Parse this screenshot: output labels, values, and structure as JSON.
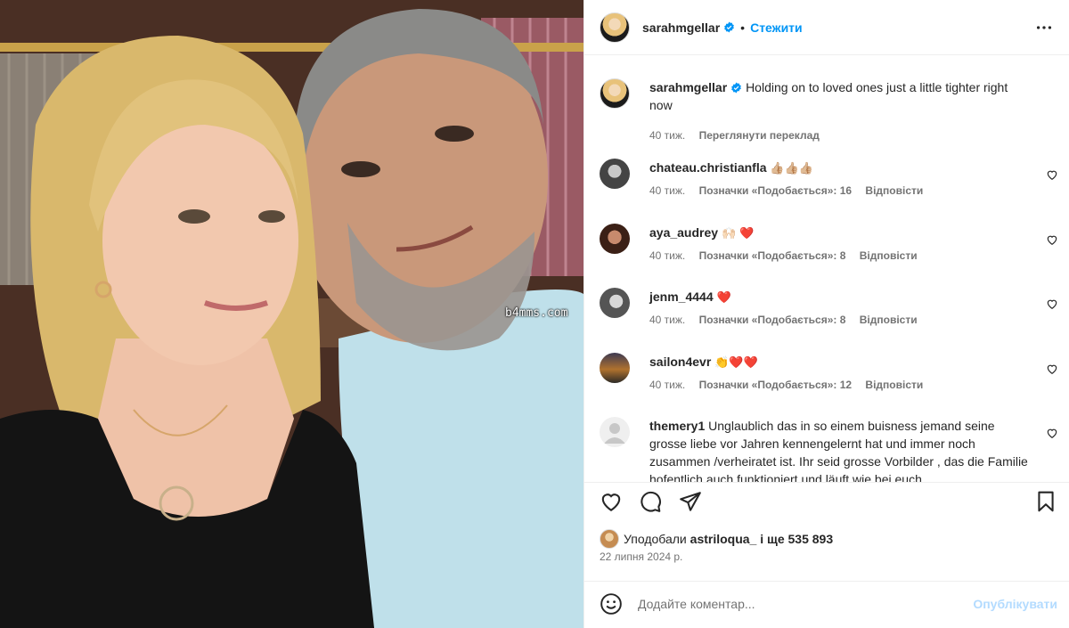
{
  "photo": {
    "watermark": "b4mms.com"
  },
  "header": {
    "username": "sarahmgellar",
    "dot": "•",
    "follow_label": "Стежити",
    "verified_icon": "verified-badge-icon",
    "more_icon": "more-options-icon"
  },
  "caption": {
    "username": "sarahmgellar",
    "text": "Holding on to loved ones just a little tighter right now",
    "time": "40 тиж.",
    "translate": "Переглянути переклад"
  },
  "comments": [
    {
      "username": "chateau.christianfla",
      "text": "👍🏼👍🏼👍🏼",
      "time": "40 тиж.",
      "likes": "Позначки «Подобається»: 16",
      "reply": "Відповісти"
    },
    {
      "username": "aya_audrey",
      "text": "🙌🏻 ❤️",
      "time": "40 тиж.",
      "likes": "Позначки «Подобається»: 8",
      "reply": "Відповісти"
    },
    {
      "username": "jenm_4444",
      "text": "❤️",
      "time": "40 тиж.",
      "likes": "Позначки «Подобається»: 8",
      "reply": "Відповісти"
    },
    {
      "username": "sailon4evr",
      "text": "👏❤️❤️",
      "time": "40 тиж.",
      "likes": "Позначки «Подобається»: 12",
      "reply": "Відповісти"
    },
    {
      "username": "themery1",
      "text": "Unglaublich das in so einem buisness jemand seine grosse liebe vor Jahren kennengelernt hat und immer noch zusammen /verheiratet ist. Ihr seid grosse Vorbilder , das die Familie hofentlich auch funktioniert und läuft wie bei euch."
    }
  ],
  "likes": {
    "prefix": "Уподобали",
    "user": "astriloqua_",
    "suffix": "і ще 535 893"
  },
  "date": "22 липня 2024 р.",
  "add_comment": {
    "placeholder": "Додайте коментар...",
    "publish": "Опублікувати"
  },
  "colors": {
    "accent": "#0095f6",
    "publish_disabled": "#b3dbff",
    "heart_red": "#ed1b3c",
    "muted_text": "#737373"
  }
}
